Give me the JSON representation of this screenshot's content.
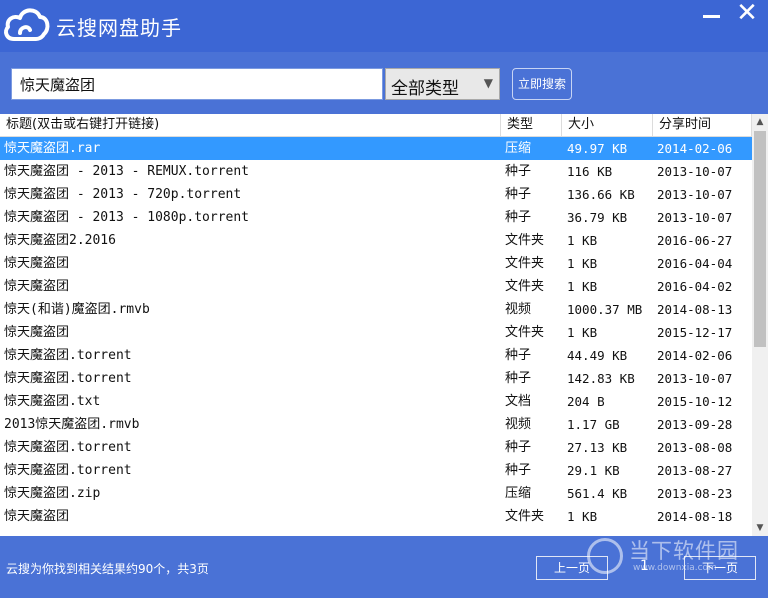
{
  "app": {
    "title": "云搜网盘助手"
  },
  "window_controls": {
    "minimize": "",
    "close": "✕"
  },
  "search": {
    "query": "惊天魔盗团",
    "type_selected": "全部类型",
    "button_label": "立即搜索"
  },
  "columns": {
    "title": "标题(双击或右键打开链接)",
    "type": "类型",
    "size": "大小",
    "time": "分享时间"
  },
  "rows": [
    {
      "title": "惊天魔盗团.rar",
      "type": "压缩",
      "size": "49.97 KB",
      "time": "2014-02-06"
    },
    {
      "title": "惊天魔盗团 - 2013 - REMUX.torrent",
      "type": "种子",
      "size": "116 KB",
      "time": "2013-10-07"
    },
    {
      "title": "惊天魔盗团 - 2013 - 720p.torrent",
      "type": "种子",
      "size": "136.66 KB",
      "time": "2013-10-07"
    },
    {
      "title": "惊天魔盗团 - 2013 - 1080p.torrent",
      "type": "种子",
      "size": "36.79 KB",
      "time": "2013-10-07"
    },
    {
      "title": "惊天魔盗团2.2016",
      "type": "文件夹",
      "size": "1 KB",
      "time": "2016-06-27"
    },
    {
      "title": "惊天魔盗团",
      "type": "文件夹",
      "size": "1 KB",
      "time": "2016-04-04"
    },
    {
      "title": "惊天魔盗团",
      "type": "文件夹",
      "size": "1 KB",
      "time": "2016-04-02"
    },
    {
      "title": "惊天(和谐)魔盗团.rmvb",
      "type": "视频",
      "size": "1000.37 MB",
      "time": "2014-08-13"
    },
    {
      "title": "惊天魔盗团",
      "type": "文件夹",
      "size": "1 KB",
      "time": "2015-12-17"
    },
    {
      "title": "惊天魔盗团.torrent",
      "type": "种子",
      "size": "44.49 KB",
      "time": "2014-02-06"
    },
    {
      "title": "惊天魔盗团.torrent",
      "type": "种子",
      "size": "142.83 KB",
      "time": "2013-10-07"
    },
    {
      "title": "惊天魔盗团.txt",
      "type": "文档",
      "size": "204 B",
      "time": "2015-10-12"
    },
    {
      "title": "2013惊天魔盗团.rmvb",
      "type": "视频",
      "size": "1.17 GB",
      "time": "2013-09-28"
    },
    {
      "title": "惊天魔盗团.torrent",
      "type": "种子",
      "size": "27.13 KB",
      "time": "2013-08-08"
    },
    {
      "title": "惊天魔盗团.torrent",
      "type": "种子",
      "size": "29.1 KB",
      "time": "2013-08-27"
    },
    {
      "title": "惊天魔盗团.zip",
      "type": "压缩",
      "size": "561.4 KB",
      "time": "2013-08-23"
    },
    {
      "title": "惊天魔盗团",
      "type": "文件夹",
      "size": "1 KB",
      "time": "2014-08-18"
    }
  ],
  "selected_row_index": 0,
  "status": {
    "text": "云搜为你找到相关结果约90个，共3页",
    "current_page": "1",
    "prev_label": "上一页",
    "next_label": "下一页"
  },
  "watermark": {
    "text": "当下软件园",
    "url": "www.downxia.com"
  },
  "colors": {
    "window_bg": "#4a72d6",
    "titlebar": "#3c66d4",
    "selection": "#3399ff"
  }
}
